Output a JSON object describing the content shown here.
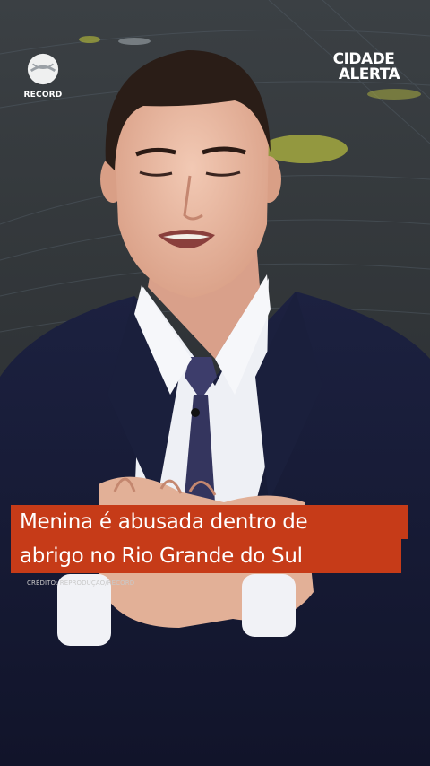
{
  "channel_logo": {
    "text": "RECORD",
    "icon": "record-disc-icon"
  },
  "show_logo": {
    "line1": "CIDADE",
    "line2": "ALERTA"
  },
  "caption": {
    "line1": "Menina é abusada dentro de",
    "line2": "abrigo no Rio Grande do Sul"
  },
  "credit": "CRÉDITO: REPRODUÇÃO/RECORD",
  "colors": {
    "caption_bg": "#c63b18",
    "caption_text": "#ffffff"
  }
}
